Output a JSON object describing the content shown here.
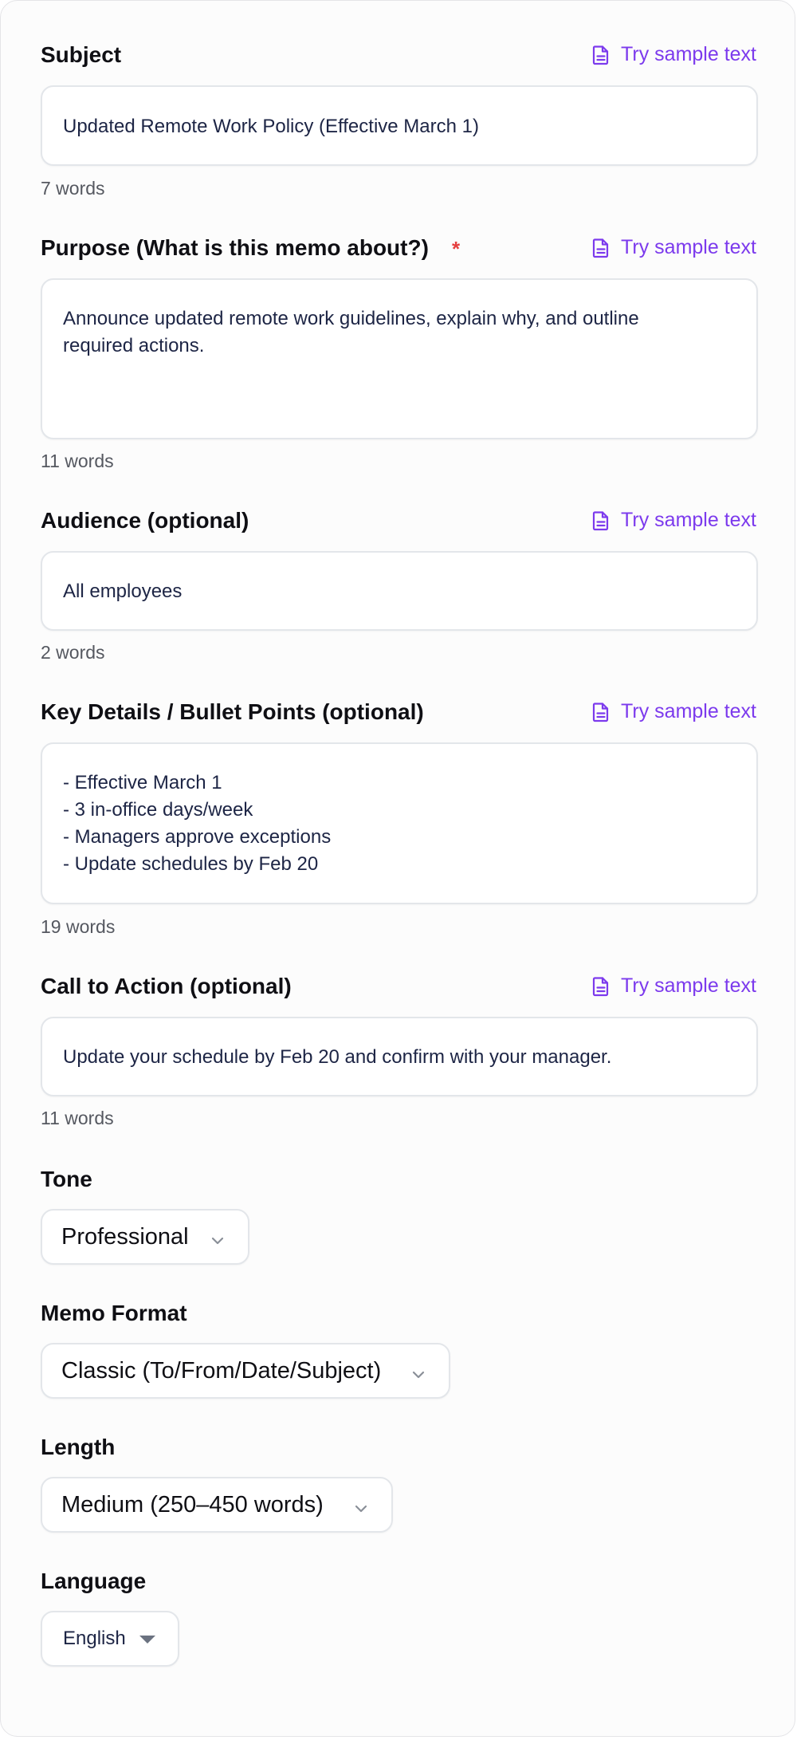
{
  "fields": {
    "subject": {
      "label": "Subject",
      "sample_link": "Try sample text",
      "value": "Updated Remote Work Policy (Effective March 1)",
      "word_count": "7 words"
    },
    "purpose": {
      "label": "Purpose (What is this memo about?)",
      "required_mark": "*",
      "sample_link": "Try sample text",
      "value": "Announce updated remote work guidelines, explain why, and outline\nrequired actions.",
      "word_count": "11 words"
    },
    "audience": {
      "label": "Audience (optional)",
      "sample_link": "Try sample text",
      "value": "All employees",
      "word_count": "2 words"
    },
    "key_details": {
      "label": "Key Details / Bullet Points (optional)",
      "sample_link": "Try sample text",
      "value": "- Effective March 1\n- 3 in-office days/week\n- Managers approve exceptions\n- Update schedules by Feb 20",
      "word_count": "19 words"
    },
    "call_to_action": {
      "label": "Call to Action (optional)",
      "sample_link": "Try sample text",
      "value": "Update your schedule by Feb 20 and confirm with your manager.",
      "word_count": "11 words"
    }
  },
  "selects": {
    "tone": {
      "label": "Tone",
      "value": "Professional"
    },
    "memo_format": {
      "label": "Memo Format",
      "value": "Classic (To/From/Date/Subject)"
    },
    "length": {
      "label": "Length",
      "value": "Medium (250–450 words)"
    },
    "language": {
      "label": "Language",
      "value": "English"
    }
  },
  "colors": {
    "accent": "#7c3aed",
    "required": "#e53e3e",
    "text": "#0f0f14",
    "input_text": "#1d2545",
    "muted": "#555860",
    "border": "#e3e6ea"
  },
  "icons": {
    "sample_link": "document-text-icon",
    "select": "chevron-down-icon",
    "language_select": "caret-down-icon"
  }
}
